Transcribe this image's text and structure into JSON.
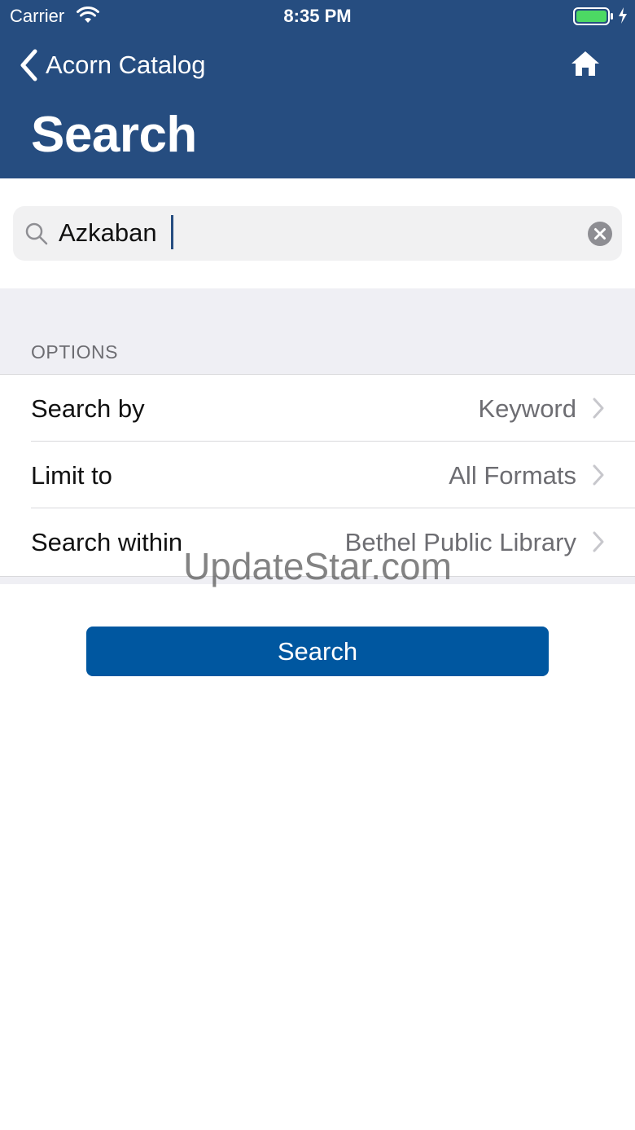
{
  "status_bar": {
    "carrier": "Carrier",
    "time": "8:35 PM"
  },
  "nav": {
    "back_label": "Acorn Catalog",
    "back_icon": "chevron-left-icon",
    "home_icon": "home-icon"
  },
  "page": {
    "title": "Search"
  },
  "search": {
    "value": "Azkaban",
    "search_icon": "search-icon",
    "clear_icon": "clear-icon"
  },
  "options": {
    "header": "OPTIONS",
    "rows": [
      {
        "label": "Search by",
        "value": "Keyword"
      },
      {
        "label": "Limit to",
        "value": "All Formats"
      },
      {
        "label": "Search within",
        "value": "Bethel Public Library"
      }
    ]
  },
  "watermark": "UpdateStar.com",
  "actions": {
    "search_label": "Search"
  },
  "colors": {
    "header_bg": "#264d80",
    "button_bg": "#0057a0",
    "section_bg": "#efeff4",
    "battery_green": "#4cd964"
  }
}
